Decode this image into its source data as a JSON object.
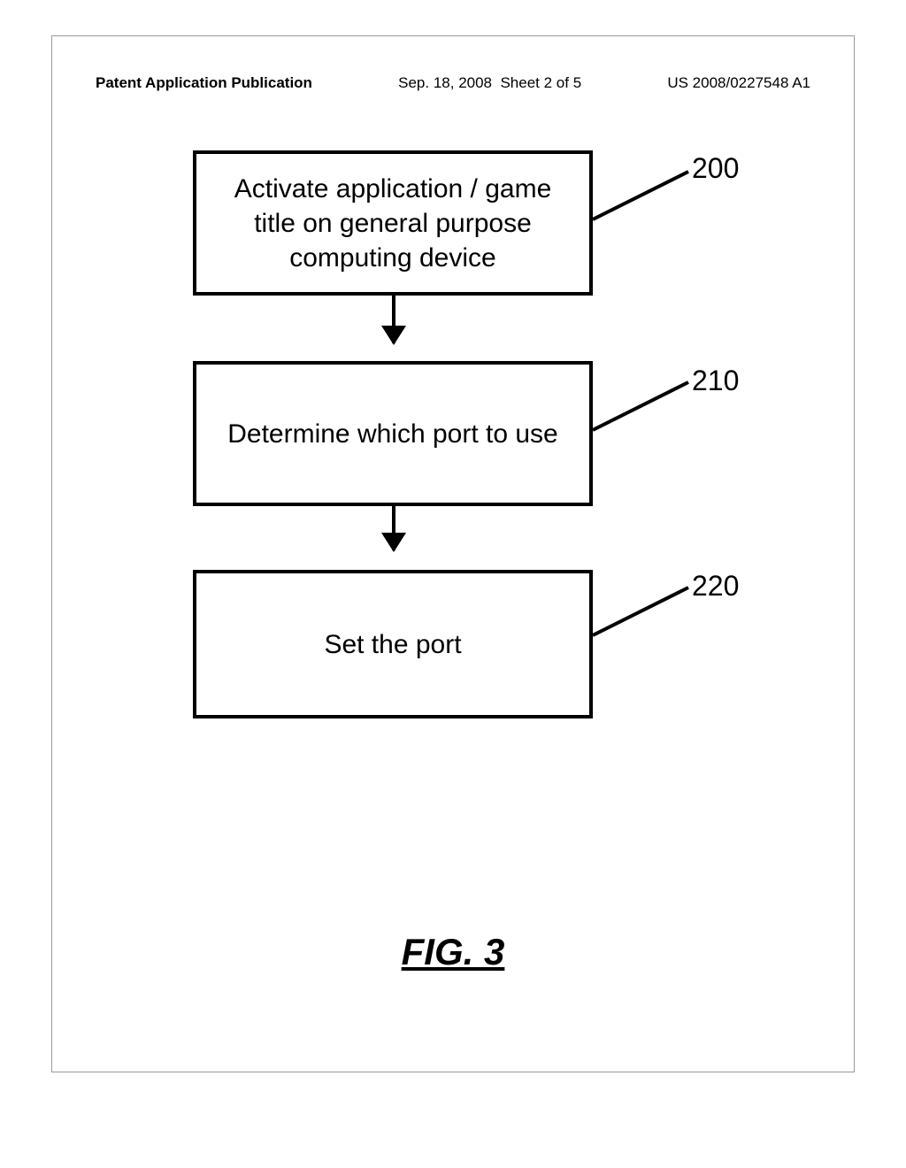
{
  "header": {
    "publication": "Patent Application Publication",
    "date": "Sep. 18, 2008",
    "sheet": "Sheet 2 of 5",
    "pubnum": "US 2008/0227548 A1"
  },
  "flowchart": {
    "boxes": [
      {
        "ref": "200",
        "text": "Activate application / game\ntitle on general purpose\ncomputing device"
      },
      {
        "ref": "210",
        "text": "Determine which port to use"
      },
      {
        "ref": "220",
        "text": "Set the port"
      }
    ]
  },
  "figure_label": "FIG. 3"
}
